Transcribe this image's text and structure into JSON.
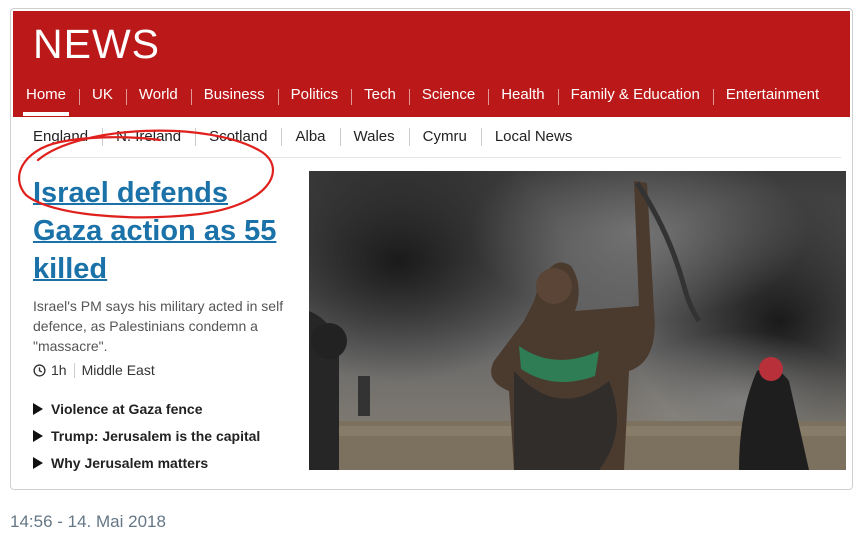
{
  "header": {
    "logo": "NEWS"
  },
  "nav": [
    {
      "label": "Home",
      "active": true
    },
    {
      "label": "UK"
    },
    {
      "label": "World"
    },
    {
      "label": "Business"
    },
    {
      "label": "Politics"
    },
    {
      "label": "Tech"
    },
    {
      "label": "Science"
    },
    {
      "label": "Health"
    },
    {
      "label": "Family & Education"
    },
    {
      "label": "Entertainment"
    }
  ],
  "subnav": [
    "England",
    "N. Ireland",
    "Scotland",
    "Alba",
    "Wales",
    "Cymru",
    "Local News"
  ],
  "story": {
    "headline": "Israel defends Gaza action as 55 killed",
    "summary": "Israel's PM says his military acted in self defence, as Palestinians condemn a \"massacre\".",
    "time": "1h",
    "section": "Middle East",
    "related": [
      "Violence at Gaza fence",
      "Trump: Jerusalem is the capital",
      "Why Jerusalem matters"
    ]
  },
  "tweet": {
    "timestamp": "14:56 - 14. Mai 2018"
  },
  "colors": {
    "bbc_red": "#bb1919",
    "link_blue": "#1a72a8",
    "annotation_red": "#e0201c"
  }
}
